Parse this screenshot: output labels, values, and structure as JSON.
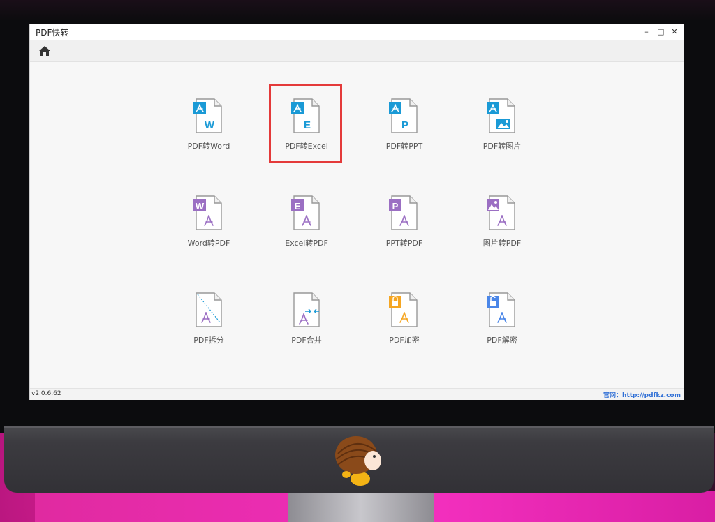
{
  "window": {
    "title": "PDF快转",
    "controls": [
      "–",
      "□",
      "✕"
    ]
  },
  "toolbar": {
    "home_icon": "home-icon",
    "right_icons": [
      "chat-icon",
      "headset-icon",
      "user-icon",
      "gear-icon"
    ]
  },
  "tools": [
    {
      "label": "PDF转Word",
      "badge": "W",
      "style": "pdf-to",
      "tag_color": "#1a9ad6"
    },
    {
      "label": "PDF转Excel",
      "badge": "E",
      "style": "pdf-to",
      "tag_color": "#1a9ad6",
      "highlighted": true
    },
    {
      "label": "PDF转PPT",
      "badge": "P",
      "style": "pdf-to",
      "tag_color": "#1a9ad6"
    },
    {
      "label": "PDF转图片",
      "badge": "image",
      "style": "pdf-to",
      "tag_color": "#1a9ad6"
    },
    {
      "label": "Word转PDF",
      "badge": "W",
      "style": "to-pdf",
      "tag_color": "#9b6fc3"
    },
    {
      "label": "Excel转PDF",
      "badge": "E",
      "style": "to-pdf",
      "tag_color": "#9b6fc3"
    },
    {
      "label": "PPT转PDF",
      "badge": "P",
      "style": "to-pdf",
      "tag_color": "#9b6fc3"
    },
    {
      "label": "图片转PDF",
      "badge": "image",
      "style": "to-pdf",
      "tag_color": "#9b6fc3"
    },
    {
      "label": "PDF拆分",
      "badge": "split",
      "style": "other",
      "tag_color": "#9b6fc3"
    },
    {
      "label": "PDF合并",
      "badge": "merge",
      "style": "other",
      "tag_color": "#1a9ad6"
    },
    {
      "label": "PDF加密",
      "badge": "lock",
      "style": "lock",
      "tag_color": "#f5a623"
    },
    {
      "label": "PDF解密",
      "badge": "unlock",
      "style": "lock",
      "tag_color": "#4a86e8"
    }
  ],
  "footer": {
    "version": "v2.0.6.62",
    "site": "官网：http://pdfkz.com"
  }
}
